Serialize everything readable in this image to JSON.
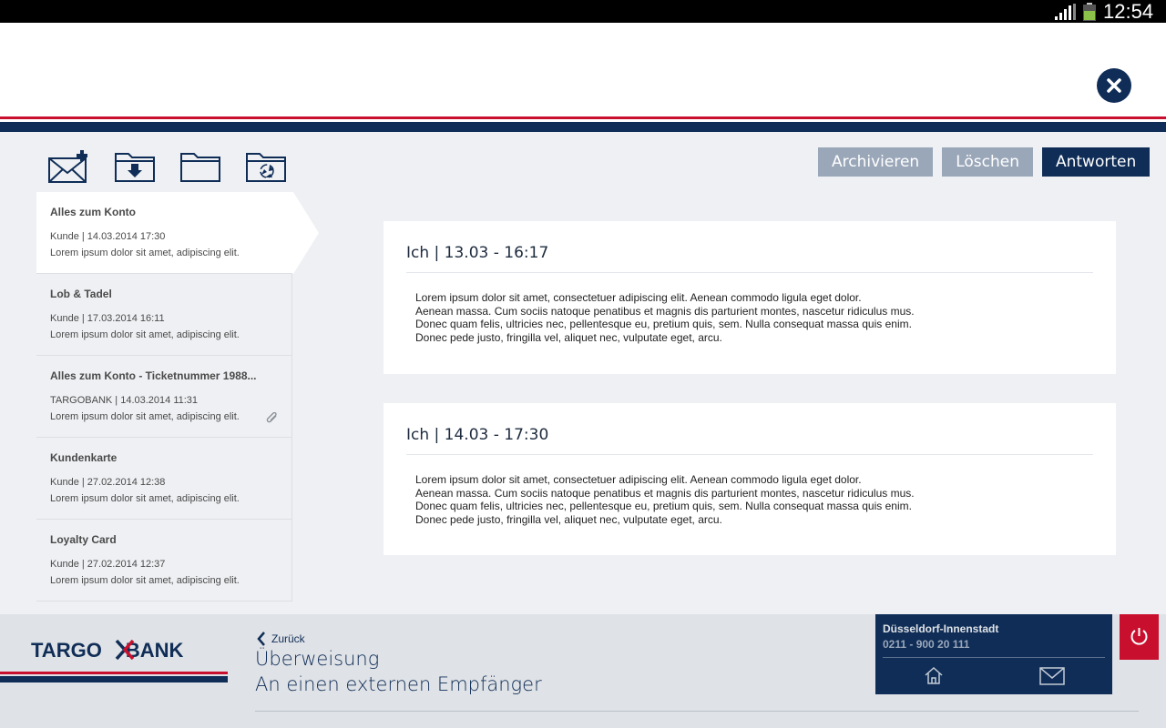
{
  "status_bar": {
    "time": "12:54"
  },
  "toolbar": {
    "folders": [
      {
        "name": "new-message-icon"
      },
      {
        "name": "inbox-folder-icon"
      },
      {
        "name": "folder-icon"
      },
      {
        "name": "recycle-folder-icon"
      }
    ],
    "buttons": {
      "archive": "Archivieren",
      "delete": "Löschen",
      "reply": "Antworten"
    }
  },
  "messages": [
    {
      "subject": "Alles zum Konto",
      "meta": "Kunde | 14.03.2014 17:30",
      "preview": "Lorem ipsum dolor sit amet, adipiscing elit."
    },
    {
      "subject": "Lob & Tadel",
      "meta": "Kunde | 17.03.2014 16:11",
      "preview": "Lorem ipsum dolor sit amet, adipiscing elit."
    },
    {
      "subject": "Alles zum Konto - Ticketnummer 1988...",
      "meta": "TARGOBANK | 14.03.2014 11:31",
      "preview": "Lorem ipsum dolor sit amet, adipiscing elit."
    },
    {
      "subject": "Kundenkarte",
      "meta": "Kunde | 27.02.2014 12:38",
      "preview": "Lorem ipsum dolor sit amet, adipiscing elit."
    },
    {
      "subject": "Loyalty Card",
      "meta": "Kunde | 27.02.2014 12:37",
      "preview": "Lorem ipsum dolor sit amet, adipiscing elit."
    }
  ],
  "thread": [
    {
      "title": "Ich | 13.03 - 16:17",
      "lines": [
        "Lorem ipsum dolor sit amet, consectetuer adipiscing elit. Aenean commodo ligula eget dolor.",
        "Aenean massa. Cum sociis natoque penatibus et magnis dis parturient montes, nascetur ridiculus mus.",
        "Donec quam felis, ultricies nec, pellentesque eu, pretium quis, sem. Nulla consequat massa quis enim.",
        "Donec pede justo, fringilla vel, aliquet nec, vulputate eget, arcu."
      ]
    },
    {
      "title": "Ich | 14.03 - 17:30",
      "lines": [
        "Lorem ipsum dolor sit amet, consectetuer adipiscing elit. Aenean commodo ligula eget dolor.",
        "Aenean massa. Cum sociis natoque penatibus et magnis dis parturient montes, nascetur ridiculus mus.",
        "Donec quam felis, ultricies nec, pellentesque eu, pretium quis, sem. Nulla consequat massa quis enim.",
        "Donec pede justo, fringilla vel, aliquet nec, vulputate eget, arcu."
      ]
    }
  ],
  "footer": {
    "logo_left": "TARGO",
    "logo_right": "BANK",
    "back_label": "Zurück",
    "nav_title": "Überweisung",
    "nav_subtitle": "An einen externen Empfänger"
  },
  "branch": {
    "name": "Düsseldorf-Innenstadt",
    "phone": "0211 - 900 20 111"
  },
  "colors": {
    "brand_blue": "#0f2d57",
    "brand_red": "#c8102e",
    "button_grey": "#9aa7b9"
  }
}
